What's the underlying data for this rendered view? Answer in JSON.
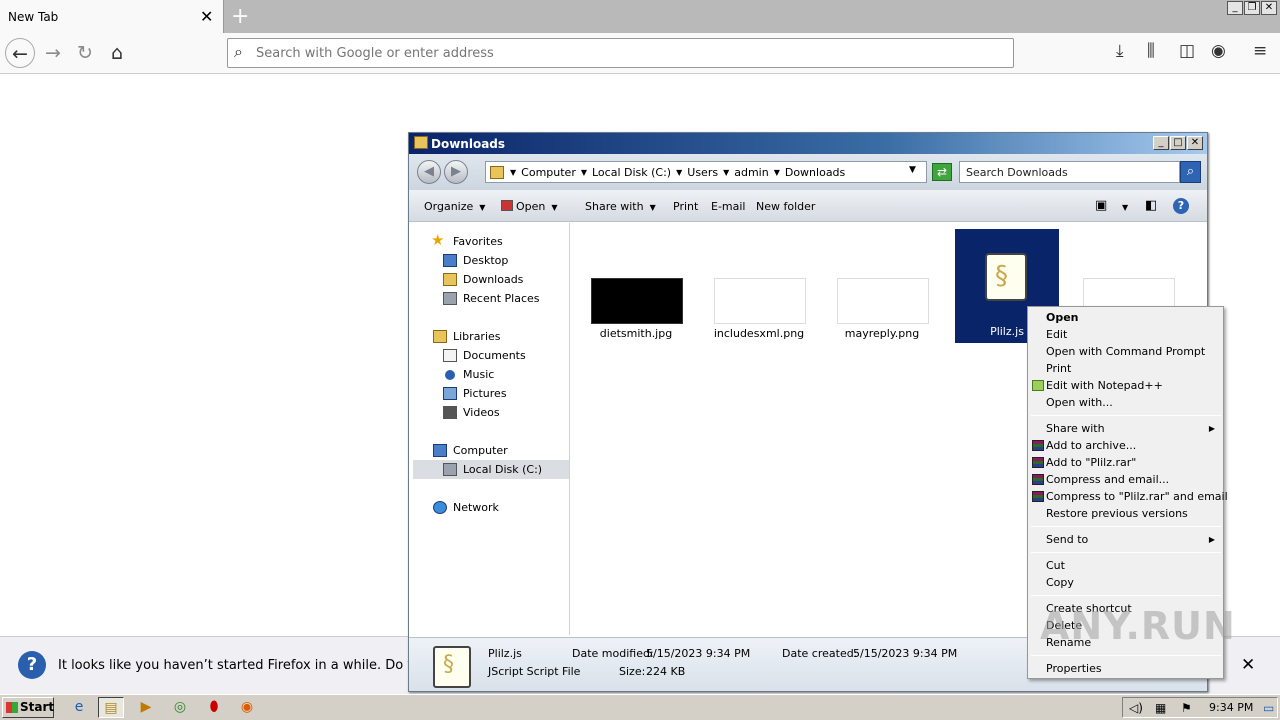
{
  "browser": {
    "tab_title": "New Tab",
    "tab_close": "✕",
    "new_tab": "+",
    "url_placeholder": "Search with Google or enter address",
    "notification": "It looks like you haven’t started Firefox in a while. Do you want to clean it up for a fresh, like-new experience?",
    "notification_close": "✕"
  },
  "explorer": {
    "title": "Downloads",
    "breadcrumb": [
      "Computer",
      "Local Disk (C:)",
      "Users",
      "admin",
      "Downloads"
    ],
    "search_placeholder": "Search Downloads",
    "commands": {
      "organize": "Organize",
      "open": "Open",
      "share_with": "Share with",
      "print": "Print",
      "email": "E-mail",
      "new_folder": "New folder"
    },
    "nav": {
      "favorites": "Favorites",
      "desktop": "Desktop",
      "downloads": "Downloads",
      "recent_places": "Recent Places",
      "libraries": "Libraries",
      "documents": "Documents",
      "music": "Music",
      "pictures": "Pictures",
      "videos": "Videos",
      "computer": "Computer",
      "local_disk": "Local Disk (C:)",
      "network": "Network"
    },
    "files": [
      {
        "name": "dietsmith.jpg"
      },
      {
        "name": "includesxml.png"
      },
      {
        "name": "mayreply.png"
      },
      {
        "name": "Plilz.js"
      }
    ],
    "details": {
      "name": "Plilz.js",
      "type": "JScript Script File",
      "date_modified_label": "Date modified:",
      "date_modified": "5/15/2023 9:34 PM",
      "date_created_label": "Date created:",
      "date_created": "5/15/2023 9:34 PM",
      "size_label": "Size:",
      "size": "224 KB"
    }
  },
  "context_menu": {
    "open": "Open",
    "edit": "Edit",
    "open_cmd": "Open with Command Prompt",
    "print": "Print",
    "edit_npp": "Edit with Notepad++",
    "open_with": "Open with...",
    "share_with": "Share with",
    "add_archive": "Add to archive...",
    "add_rar": "Add to \"Plilz.rar\"",
    "compress_email": "Compress and email...",
    "compress_rar_email": "Compress to \"Plilz.rar\" and email",
    "restore": "Restore previous versions",
    "send_to": "Send to",
    "cut": "Cut",
    "copy": "Copy",
    "create_shortcut": "Create shortcut",
    "delete": "Delete",
    "rename": "Rename",
    "properties": "Properties"
  },
  "watermark": "ANY.RUN",
  "taskbar": {
    "start": "Start",
    "clock": "9:34 PM"
  }
}
